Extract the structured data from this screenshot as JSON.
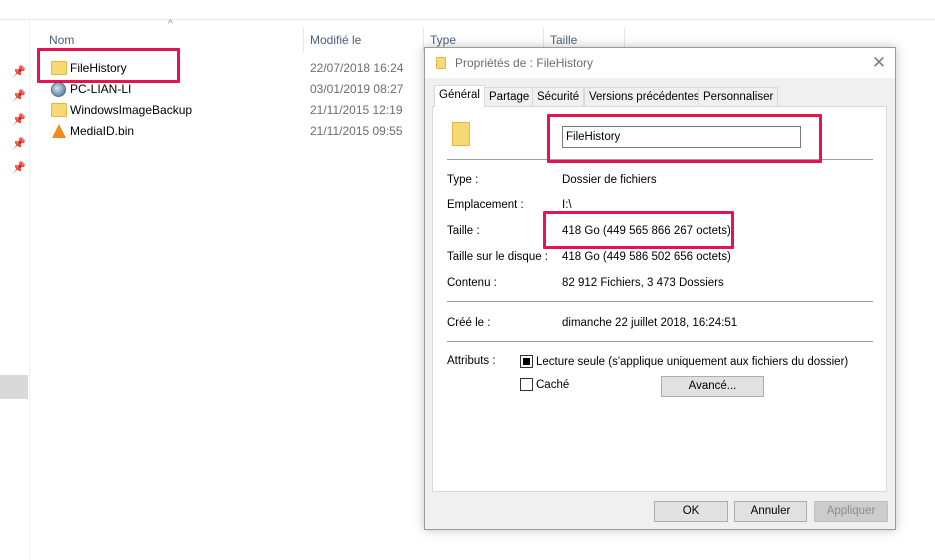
{
  "explorer": {
    "columns": {
      "name": "Nom",
      "modified": "Modifié le",
      "type": "Type",
      "size": "Taille"
    },
    "files": [
      {
        "name": "FileHistory",
        "date": "22/07/2018 16:24",
        "icon": "folder-icon"
      },
      {
        "name": "PC-LIAN-LI",
        "date": "03/01/2019 08:27",
        "icon": "computer-network-icon"
      },
      {
        "name": "WindowsImageBackup",
        "date": "21/11/2015 12:19",
        "icon": "folder-icon"
      },
      {
        "name": "MediaID.bin",
        "date": "21/11/2015 09:55",
        "icon": "vlc-cone-icon"
      }
    ],
    "sort_indicator": "^"
  },
  "dialog": {
    "title": "Propriétés de : FileHistory",
    "close_glyph": "✕",
    "tabs": [
      {
        "label": "Général",
        "active": true
      },
      {
        "label": "Partage",
        "active": false
      },
      {
        "label": "Sécurité",
        "active": false
      },
      {
        "label": "Versions précédentes",
        "active": false
      },
      {
        "label": "Personnaliser",
        "active": false
      }
    ],
    "folder_name": "FileHistory",
    "properties": {
      "type_label": "Type :",
      "type_value": "Dossier de fichiers",
      "location_label": "Emplacement :",
      "location_value": "I:\\",
      "size_label": "Taille :",
      "size_value": "418 Go (449 565 866 267 octets)",
      "disk_size_label": "Taille sur le disque :",
      "disk_size_value": "418 Go (449 586 502 656 octets)",
      "contents_label": "Contenu :",
      "contents_value": "82 912 Fichiers, 3 473 Dossiers",
      "created_label": "Créé le :",
      "created_value": "dimanche 22 juillet 2018, 16:24:51"
    },
    "attributes": {
      "label": "Attributs :",
      "readonly_label": "Lecture seule (s'applique uniquement aux fichiers du dossier)",
      "readonly_state": "indeterminate",
      "hidden_label": "Caché",
      "hidden_checked": false,
      "advanced_button": "Avancé..."
    },
    "buttons": {
      "ok": "OK",
      "cancel": "Annuler",
      "apply": "Appliquer"
    }
  },
  "colors": {
    "highlight": "#e3144f",
    "folder": "#f8d775",
    "header_text": "#4c607a"
  }
}
